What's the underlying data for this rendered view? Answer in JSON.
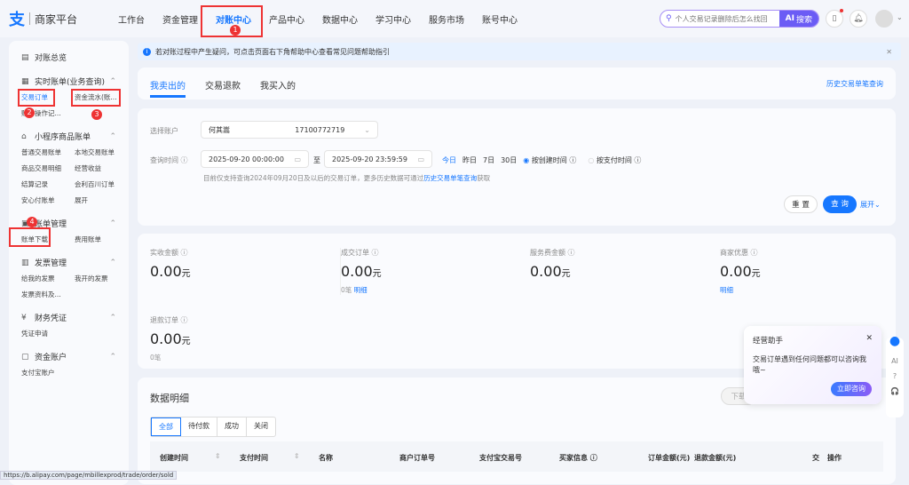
{
  "header": {
    "logo": "支",
    "title": "商家平台",
    "nav": [
      "工作台",
      "资金管理",
      "对账中心",
      "产品中心",
      "数据中心",
      "学习中心",
      "服务市场",
      "账号中心"
    ],
    "search_placeholder": "个人交易记录删除后怎么找回",
    "search_button": "搜索",
    "ai_label": "AI"
  },
  "annotations": [
    "1",
    "2",
    "3",
    "4"
  ],
  "sidebar": {
    "overview": "对账总览",
    "sections": [
      {
        "title": "实时账单(业务查询)",
        "items": [
          "交易订单",
          "资金流水(账...",
          "账户操作记..."
        ]
      },
      {
        "title": "小程序商品账单",
        "items": [
          "普通交易账单",
          "本地交易账单",
          "商品交易明细",
          "经营收益",
          "结算记录",
          "会利百川订单",
          "安心付账单",
          "展开"
        ]
      },
      {
        "title": "账单管理",
        "items": [
          "账单下载",
          "费用账单"
        ]
      },
      {
        "title": "发票管理",
        "items": [
          "给我的发票",
          "我开的发票",
          "发票资料及..."
        ]
      },
      {
        "title": "财务凭证",
        "items": [
          "凭证申请"
        ]
      },
      {
        "title": "资金账户",
        "items": [
          "支付宝账户"
        ]
      }
    ]
  },
  "notice": "若对账过程中产生疑问，可点击页面右下角帮助中心查看常见问题帮助指引",
  "tabs": [
    "我卖出的",
    "交易退款",
    "我买入的"
  ],
  "history_link": "历史交易单笔查询",
  "filter": {
    "account_label": "选择账户",
    "account_name": "何其嵩",
    "account_id": "17100772719",
    "time_label": "查询时间",
    "start": "2025-09-20 00:00:00",
    "to": "至",
    "end": "2025-09-20 23:59:59",
    "quick": [
      "今日",
      "昨日",
      "7日",
      "30日"
    ],
    "radio1": "按创建时间",
    "radio2": "按支付时间",
    "hint": "目前仅支持查询2024年09月20日及以后的交易订单，更多历史数据可通过",
    "hint_link": "历史交易单笔查询",
    "hint_tail": "获取",
    "reset": "重 置",
    "query": "查 询",
    "expand": "展开"
  },
  "stats": [
    {
      "label": "实收金额",
      "value": "0.00",
      "unit": "元"
    },
    {
      "label": "成交订单",
      "value": "0.00",
      "unit": "元",
      "sub": "0笔",
      "link": "明细"
    },
    {
      "label": "服务费金额",
      "value": "0.00",
      "unit": "元"
    },
    {
      "label": "商家优惠",
      "value": "0.00",
      "unit": "元",
      "link": "明细"
    },
    {
      "label": "退款订单",
      "value": "0.00",
      "unit": "元",
      "sub": "0笔"
    }
  ],
  "detail": {
    "title": "数据明细",
    "download": "下载",
    "filters": [
      "全部",
      "待付款",
      "成功",
      "关闭"
    ],
    "columns": [
      "创建时间",
      "支付时间",
      "名称",
      "商户订单号",
      "支付宝交易号",
      "买家信息",
      "订单金额(元)",
      "退款金额(元)",
      "交",
      "操作"
    ]
  },
  "assistant": {
    "title": "经营助手",
    "body": "交易订单遇到任何问题都可以咨询我哦~",
    "button": "立即咨询",
    "side": [
      "AI",
      "?",
      "🎧"
    ]
  },
  "status_url": "https://b.alipay.com/page/mbillexprod/trade/order/sold"
}
